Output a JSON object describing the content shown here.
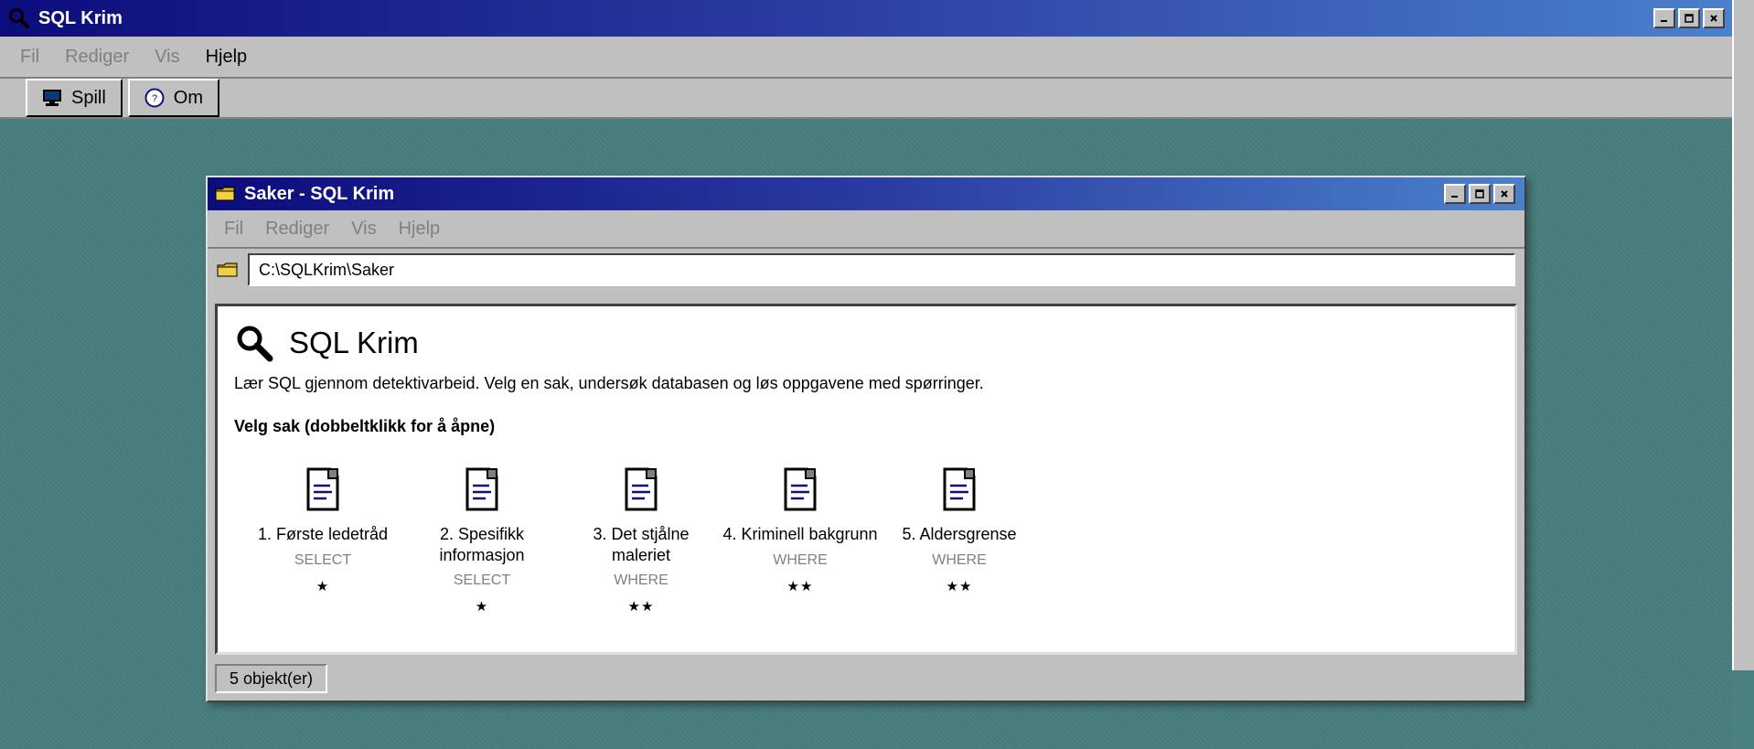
{
  "app": {
    "title": "SQL Krim",
    "menu": [
      "Fil",
      "Rediger",
      "Vis",
      "Hjelp"
    ],
    "toolbar": {
      "play_label": "Spill",
      "about_label": "Om"
    }
  },
  "window": {
    "title": "Saker - SQL Krim",
    "menu": [
      "Fil",
      "Rediger",
      "Vis",
      "Hjelp"
    ],
    "address": "C:\\SQLKrim\\Saker",
    "heading": "SQL Krim",
    "intro": "Lær SQL gjennom detektivarbeid. Velg en sak, undersøk databasen og løs oppgavene med spørringer.",
    "section_label": "Velg sak (dobbeltklikk for å åpne)",
    "cases": [
      {
        "title": "1. Første ledetråd",
        "tag": "SELECT",
        "stars": "★"
      },
      {
        "title": "2. Spesifikk informasjon",
        "tag": "SELECT",
        "stars": "★"
      },
      {
        "title": "3. Det stjålne maleriet",
        "tag": "WHERE",
        "stars": "★★"
      },
      {
        "title": "4. Kriminell bakgrunn",
        "tag": "WHERE",
        "stars": "★★"
      },
      {
        "title": "5. Aldersgrense",
        "tag": "WHERE",
        "stars": "★★"
      }
    ],
    "status": "5 objekt(er)"
  }
}
